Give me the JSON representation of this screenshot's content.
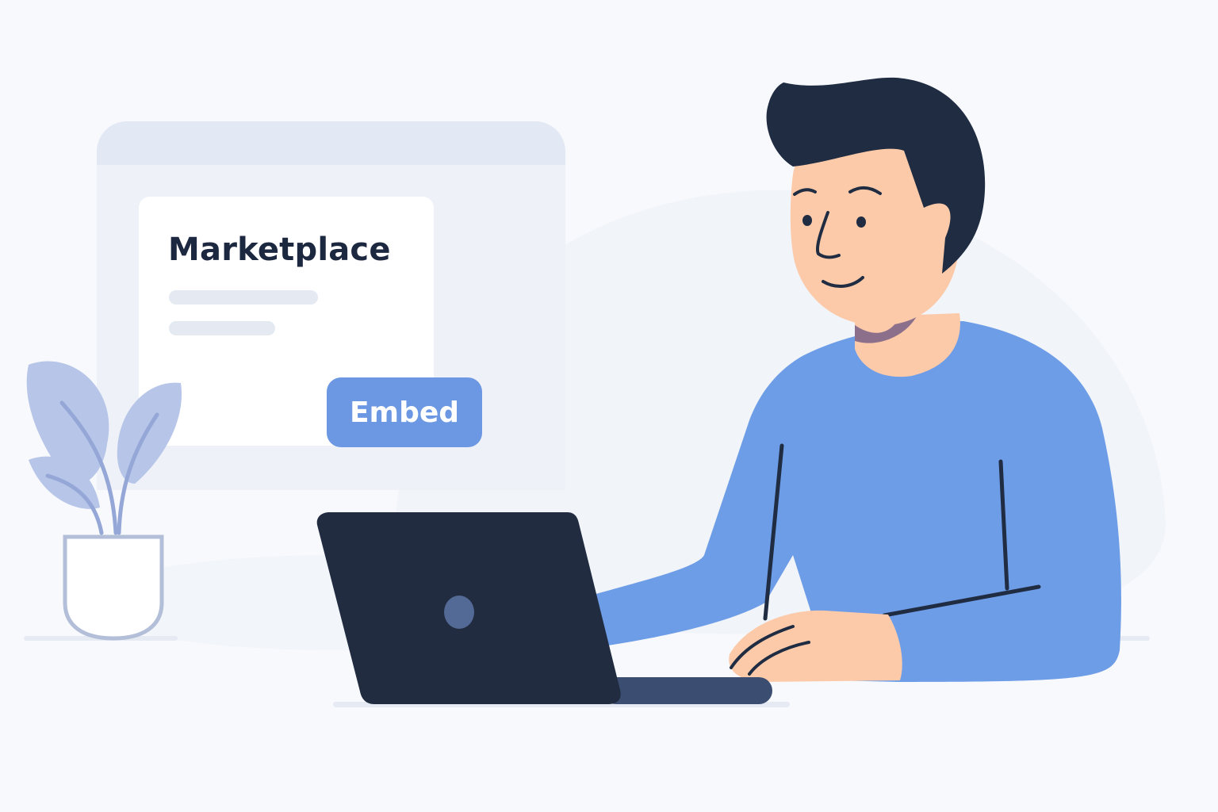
{
  "card": {
    "title": "Marketplace",
    "embed_label": "Embed"
  },
  "icons": {
    "plant": "potted-plant-icon",
    "laptop": "laptop-icon",
    "person": "person-illustration"
  },
  "colors": {
    "background": "#f8f9fc",
    "window_frame": "#eef1f7",
    "window_header": "#e2e8f4",
    "card": "#ffffff",
    "title_text": "#1c2740",
    "accent_button": "#6b97e3",
    "sweater": "#6e9de8",
    "skin": "#fccaa9",
    "hair": "#1f2c42",
    "laptop": "#212c41",
    "plant": "#b6c5e8"
  }
}
